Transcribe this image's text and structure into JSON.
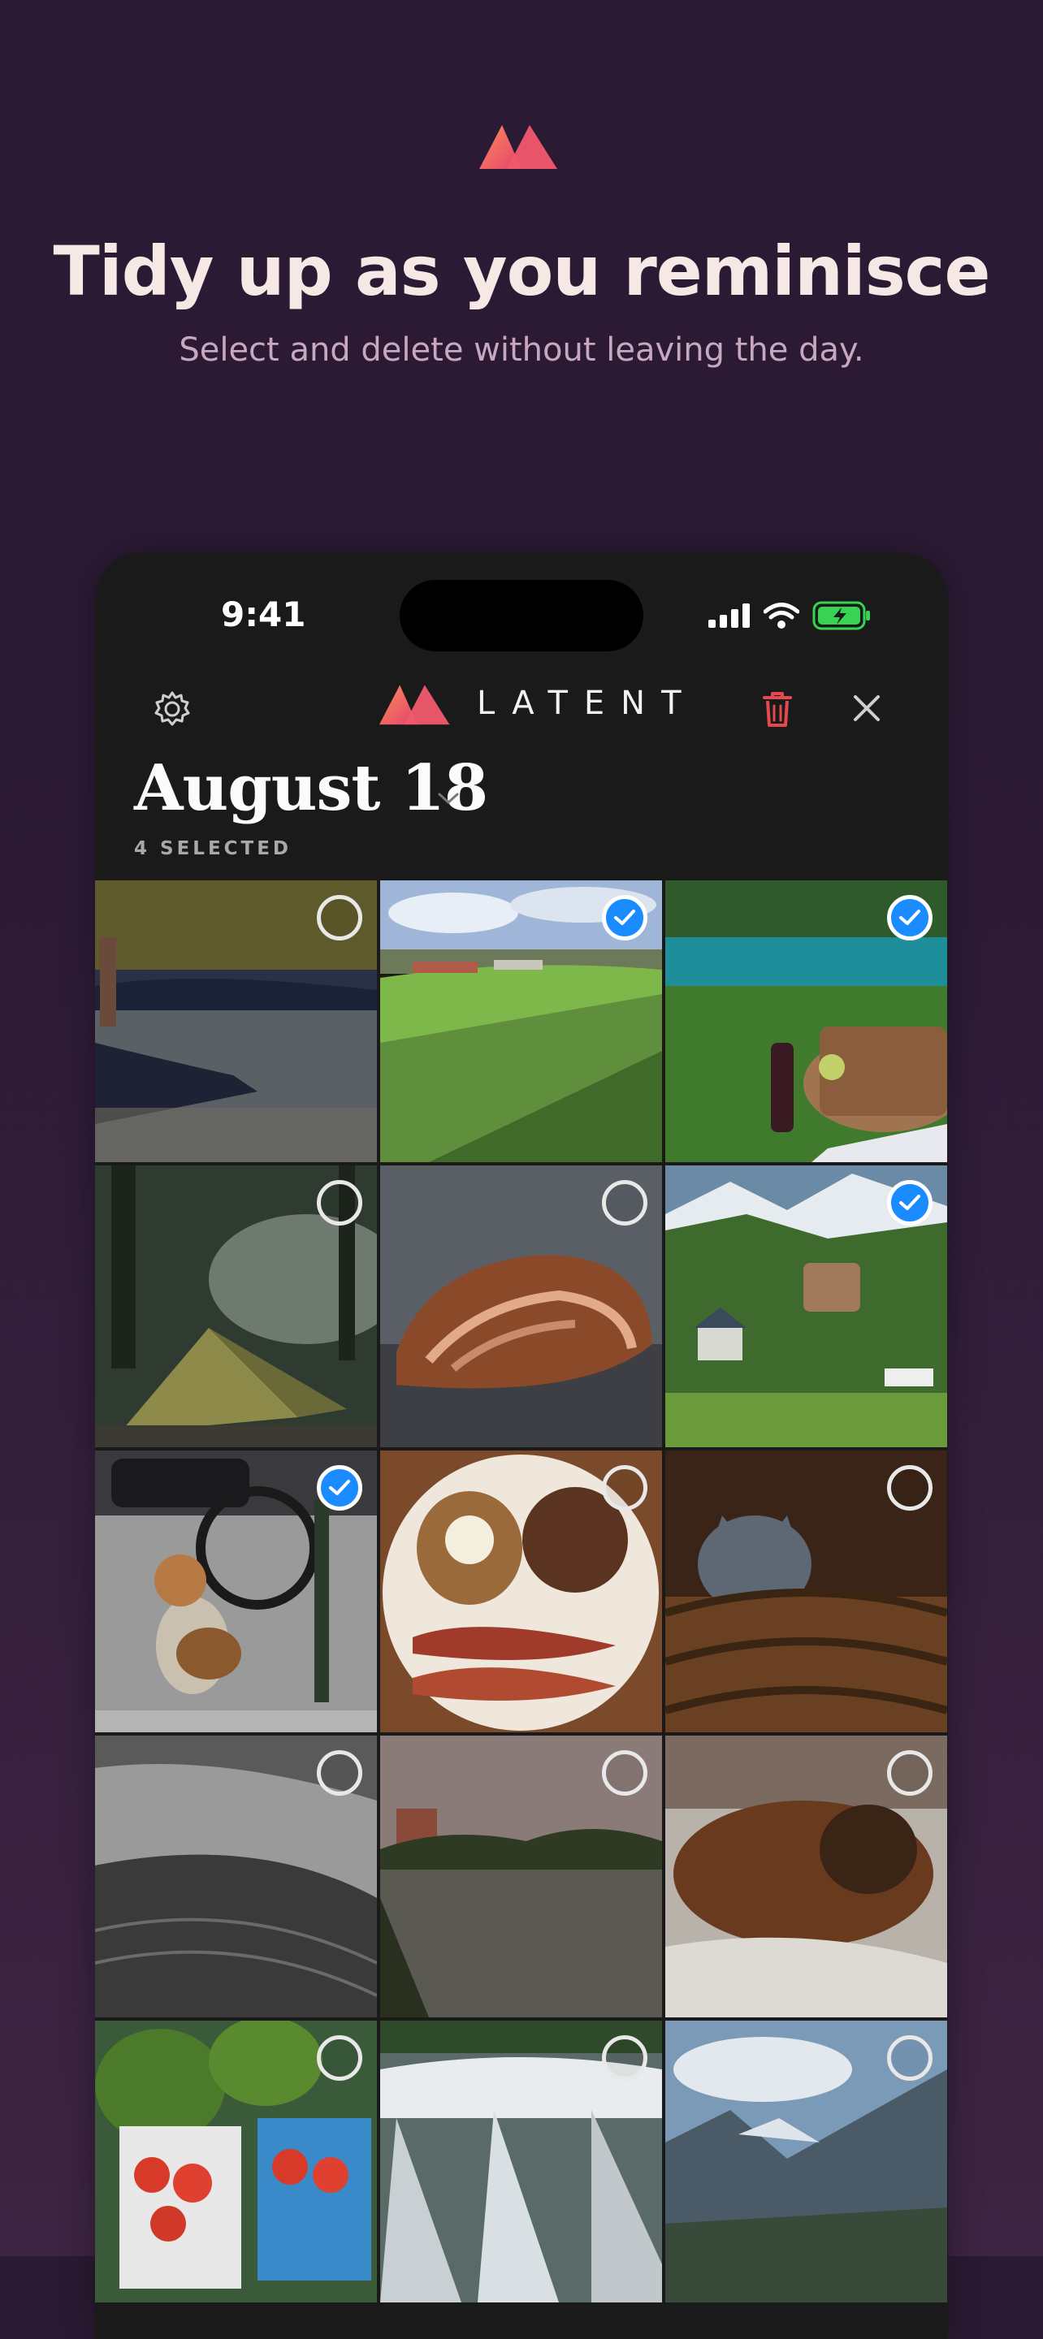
{
  "promo": {
    "headline": "Tidy up as you reminisce",
    "subhead": "Select and delete without leaving the day."
  },
  "status_bar": {
    "time": "9:41",
    "icons": [
      "cellular-signal-icon",
      "wifi-icon",
      "battery-charging-icon"
    ]
  },
  "app_header": {
    "brand": "LATENT",
    "settings_icon": "gear-icon",
    "delete_icon": "trash-icon",
    "close_icon": "close-icon"
  },
  "day": {
    "title": "August 18",
    "selected_count": "4 SELECTED"
  },
  "colors": {
    "accent_blue": "#1a8cff",
    "delete_red": "#e5484d",
    "brand_gradient_start": "#ff7a59",
    "brand_gradient_end": "#e0476a"
  },
  "photos": [
    {
      "subject": "lighthouse-harbor",
      "selected": false
    },
    {
      "subject": "green-field-village",
      "selected": true
    },
    {
      "subject": "picnic-basket-lake",
      "selected": true
    },
    {
      "subject": "tent-forest",
      "selected": false
    },
    {
      "subject": "seashell",
      "selected": false
    },
    {
      "subject": "mountain-valley-houses",
      "selected": true
    },
    {
      "subject": "beagle-bicycle",
      "selected": true
    },
    {
      "subject": "breakfast-plate-bacon",
      "selected": false
    },
    {
      "subject": "kitten-basket",
      "selected": false
    },
    {
      "subject": "sand-dunes-bw",
      "selected": false
    },
    {
      "subject": "lake-dusk",
      "selected": false
    },
    {
      "subject": "sleeping-cat-blanket",
      "selected": false
    },
    {
      "subject": "watermelons-tomatoes",
      "selected": false
    },
    {
      "subject": "waterfall",
      "selected": false
    },
    {
      "subject": "fjord-mountains",
      "selected": false
    }
  ]
}
